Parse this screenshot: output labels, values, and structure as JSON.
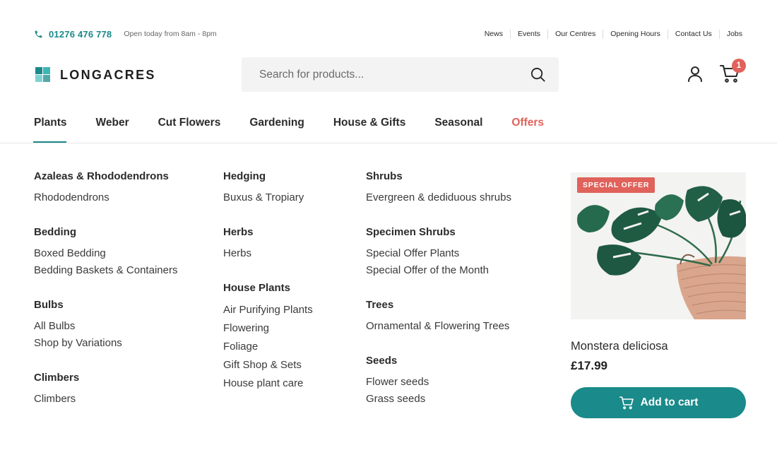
{
  "topbar": {
    "phone": "01276 476 778",
    "hours": "Open today from 8am -  8pm",
    "links": [
      "News",
      "Events",
      "Our Centres",
      "Opening Hours",
      "Contact Us",
      "Jobs"
    ]
  },
  "header": {
    "logo_text": "LONGACRES",
    "search_placeholder": "Search for products...",
    "cart_count": "1"
  },
  "nav": {
    "items": [
      "Plants",
      "Weber",
      "Cut Flowers",
      "Gardening",
      "House & Gifts",
      "Seasonal",
      "Offers"
    ]
  },
  "menu": {
    "col1": [
      {
        "title": "Azaleas & Rhododendrons",
        "links": [
          "Rhododendrons"
        ]
      },
      {
        "title": "Bedding",
        "links": [
          "Boxed Bedding",
          "Bedding Baskets & Containers"
        ]
      },
      {
        "title": "Bulbs",
        "links": [
          "All Bulbs",
          "Shop by Variations"
        ]
      },
      {
        "title": "Climbers",
        "links": [
          "Climbers"
        ]
      }
    ],
    "col2": [
      {
        "title": "Hedging",
        "links": [
          "Buxus & Tropiary"
        ]
      },
      {
        "title": "Herbs",
        "links": [
          "Herbs"
        ]
      },
      {
        "title": "House Plants",
        "links": [
          "Air Purifying Plants",
          "Flowering",
          "Foliage",
          "Gift Shop & Sets",
          "House plant care"
        ]
      }
    ],
    "col3": [
      {
        "title": "Shrubs",
        "links": [
          "Evergreen & dediduous shrubs"
        ]
      },
      {
        "title": "Specimen Shrubs",
        "links": [
          "Special Offer Plants",
          "Special Offer of the Month"
        ]
      },
      {
        "title": "Trees",
        "links": [
          "Ornamental & Flowering Trees"
        ]
      },
      {
        "title": "Seeds",
        "links": [
          "Flower seeds",
          "Grass seeds"
        ]
      }
    ]
  },
  "product": {
    "badge": "SPECIAL OFFER",
    "name": "Monstera deliciosa",
    "price": "£17.99",
    "button": "Add to cart"
  },
  "colors": {
    "accent": "#1a8a8a",
    "offer": "#e0625b"
  }
}
